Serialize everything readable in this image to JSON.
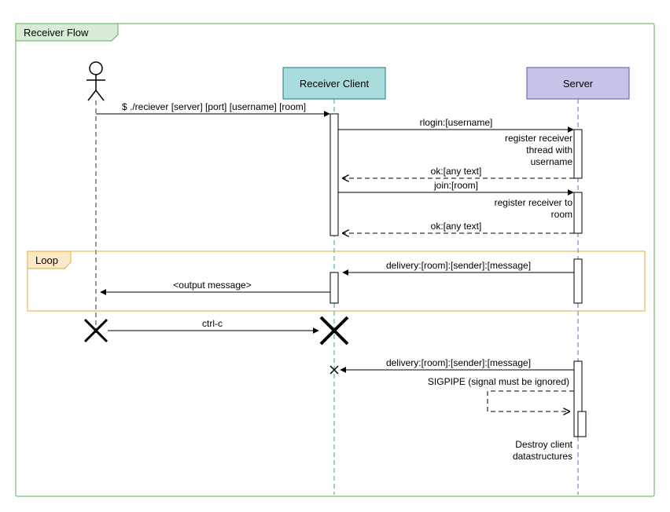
{
  "title": "Receiver Flow",
  "participants": {
    "actor": "Actor",
    "receiver": "Receiver Client",
    "server": "Server"
  },
  "loop_label": "Loop",
  "messages": {
    "m1": "$ ./reciever [server] [port] [username] [room]",
    "m2": "rlogin:[username]",
    "m3": "ok:[any text]",
    "m4": "join:[room]",
    "m5": "ok:[any text]",
    "m6": "delivery:[room]:[sender]:[message]",
    "m7": "<output message>",
    "m8": "ctrl-c",
    "m9": "delivery:[room]:[sender]:[message]",
    "m10": "SIGPIPE (signal must be ignored)"
  },
  "notes": {
    "n1a": "register receiver",
    "n1b": "thread with",
    "n1c": "username",
    "n2a": "register receiver to",
    "n2b": "room",
    "n3a": "Destroy client",
    "n3b": "datastructures"
  }
}
